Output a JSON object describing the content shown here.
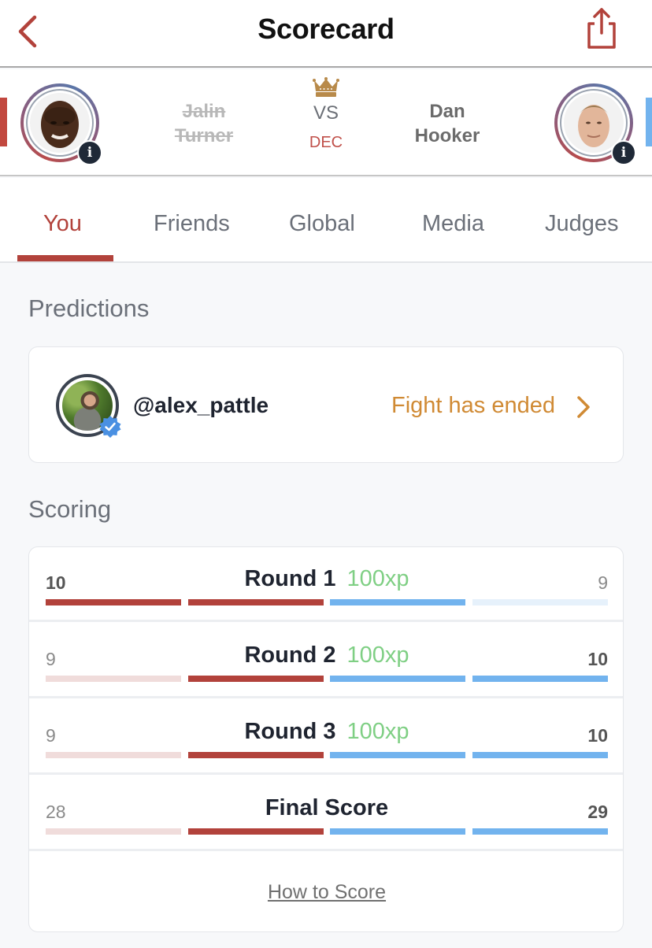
{
  "header": {
    "title": "Scorecard",
    "back_icon": "chevron-left-icon",
    "share_icon": "share-icon"
  },
  "fight": {
    "red_corner": {
      "first_name": "Jalin",
      "last_name": "Turner",
      "result": "loss"
    },
    "blue_corner": {
      "first_name": "Dan",
      "last_name": "Hooker",
      "result": "win"
    },
    "vs_label": "VS",
    "method": "DEC",
    "crown_icon": "crown-icon",
    "info_label": "i"
  },
  "tabs": [
    {
      "label": "You",
      "active": true
    },
    {
      "label": "Friends",
      "active": false
    },
    {
      "label": "Global",
      "active": false
    },
    {
      "label": "Media",
      "active": false
    },
    {
      "label": "Judges",
      "active": false
    }
  ],
  "predictions": {
    "title": "Predictions",
    "username": "@alex_pattle",
    "status": "Fight has ended"
  },
  "scoring": {
    "title": "Scoring",
    "rounds": [
      {
        "label": "Round 1",
        "xp": "100xp",
        "red": "10",
        "blue": "9",
        "winner": "red"
      },
      {
        "label": "Round 2",
        "xp": "100xp",
        "red": "9",
        "blue": "10",
        "winner": "blue"
      },
      {
        "label": "Round 3",
        "xp": "100xp",
        "red": "9",
        "blue": "10",
        "winner": "blue"
      }
    ],
    "final": {
      "label": "Final Score",
      "red": "28",
      "blue": "29",
      "winner": "blue"
    },
    "how_to_link": "How to Score"
  },
  "colors": {
    "red": "#b2423b",
    "red_faded": "#f0dcdb",
    "blue": "#72b3ee",
    "blue_faded": "#e6f1fb",
    "gold": "#d08a34",
    "xp_green": "#7fcf84"
  }
}
